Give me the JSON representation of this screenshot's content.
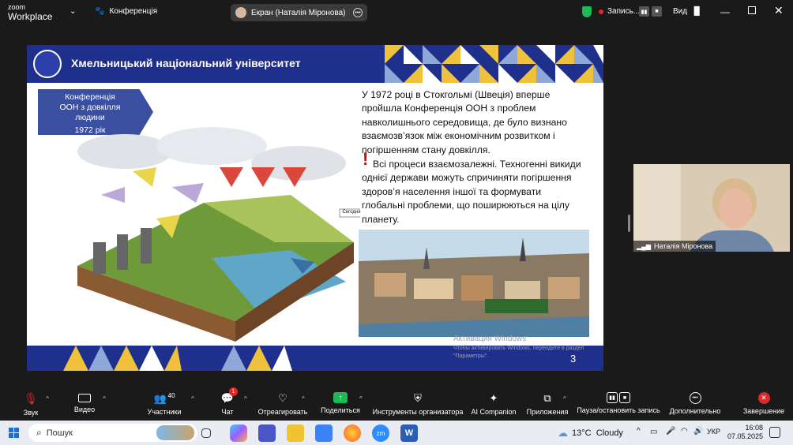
{
  "app": {
    "logo_line1": "zoom",
    "logo_line2": "Workplace",
    "meeting_title": "Конференція"
  },
  "share_pill": {
    "label": "Екран (Наталія Міронова)"
  },
  "recording": {
    "label": "Запись..."
  },
  "view": {
    "label": "Вид"
  },
  "slide": {
    "university": "Хмельницький національний університет",
    "badge_line1": "Конференція",
    "badge_line2": "ООН з довкілля",
    "badge_line3": "людини",
    "badge_year": "1972 рік",
    "para1": "У 1972 році в Стокгольмі (Швеція) вперше пройшла Конференція ООН з проблем навколишнього середовища, де було визнано взаємозв’язок між економічним розвитком і погіршенням стану довкілля.",
    "exclaim": "!",
    "para2": "Всі процеси взаємозалежні. Техногенні викиди однієї держави можуть спричиняти погіршення здоров’я населення іншої та формувати глобальні проблеми, що поширюються на цілу планету.",
    "diagram_label_today": "Сегодня",
    "page_number": "3"
  },
  "watermark": {
    "line1": "Активация Windows",
    "line2": "Чтобы активировать Windows, перейдите в раздел",
    "line3": "\"Параметры\"."
  },
  "video_tile": {
    "name": "Наталія Міронова"
  },
  "toolbar": {
    "audio": "Звук",
    "video": "Видео",
    "participants": "Участники",
    "participants_count": "40",
    "chat": "Чат",
    "chat_badge": "1",
    "react": "Отреагировать",
    "share": "Поделиться",
    "host_tools": "Инструменты организатора",
    "companion": "AI Companion",
    "apps": "Приложения",
    "pause_record": "Пауза/остановить запись",
    "more": "Дополнительно",
    "end": "Завершение"
  },
  "taskbar": {
    "search_placeholder": "Пошук",
    "weather": "13°C  Cloudy",
    "lang": "УКР",
    "time": "16:08",
    "date": "07.05.2025"
  },
  "colors": {
    "slide_blue": "#1f2f8c",
    "badge_blue": "#3b4fa0",
    "share_green": "#1db954",
    "end_red": "#e02828",
    "exclaim_red": "#e00000"
  }
}
